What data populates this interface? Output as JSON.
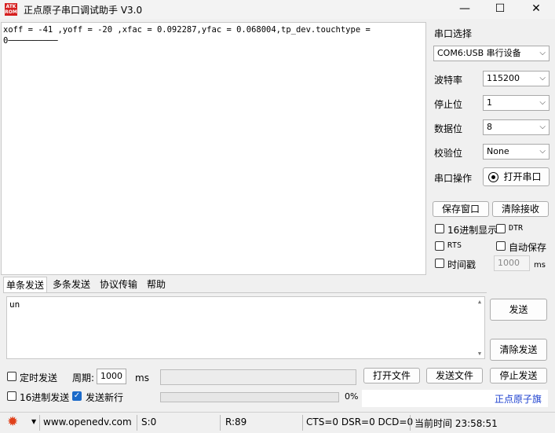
{
  "window": {
    "logo_text": "ATK ROM",
    "title": "正点原子串口调试助手 V3.0",
    "minimize_glyph": "—",
    "maximize_glyph": "☐",
    "close_glyph": "✕"
  },
  "receive": {
    "lines": [
      "xoff = -41 ,yoff = -20 ,xfac = 0.092287,yfac = 0.068004,tp_dev.touchtype =",
      "0──────────"
    ]
  },
  "serial": {
    "section_label": "串口选择",
    "port_value": "COM6:USB 串行设备",
    "baud_label": "波特率",
    "baud_value": "115200",
    "stop_label": "停止位",
    "stop_value": "1",
    "data_label": "数据位",
    "data_value": "8",
    "parity_label": "校验位",
    "parity_value": "None",
    "op_label": "串口操作",
    "open_button": "打开串口"
  },
  "buttons": {
    "save_window": "保存窗口",
    "clear_receive": "清除接收"
  },
  "options": {
    "hex_display": "16进制显示",
    "dtr": "DTR",
    "rts": "RTS",
    "auto_save": "自动保存",
    "timestamp": "时间戳",
    "timestamp_value": "1000",
    "timestamp_unit": "ms"
  },
  "tabs": [
    "单条发送",
    "多条发送",
    "协议传输",
    "帮助"
  ],
  "send": {
    "text": "un",
    "send_button": "发送",
    "clear_send_button": "清除发送",
    "timed_send": "定时发送",
    "period_label": "周期:",
    "period_value": "1000",
    "period_unit": "ms",
    "open_file": "打开文件",
    "send_file": "发送文件",
    "stop_send": "停止发送",
    "hex_send": "16进制发送",
    "send_newline": "发送新行",
    "progress_percent": "0%",
    "brand_link": "正点原子旗"
  },
  "status": {
    "url": "www.openedv.com",
    "sent": "S:0",
    "received": "R:89",
    "lines": "CTS=0 DSR=0 DCD=0",
    "time": "当前时间 23:58:51"
  },
  "colors": {
    "accent": "#1b6ac9",
    "gear": "#e0401a",
    "logo": "#d51f1f"
  }
}
